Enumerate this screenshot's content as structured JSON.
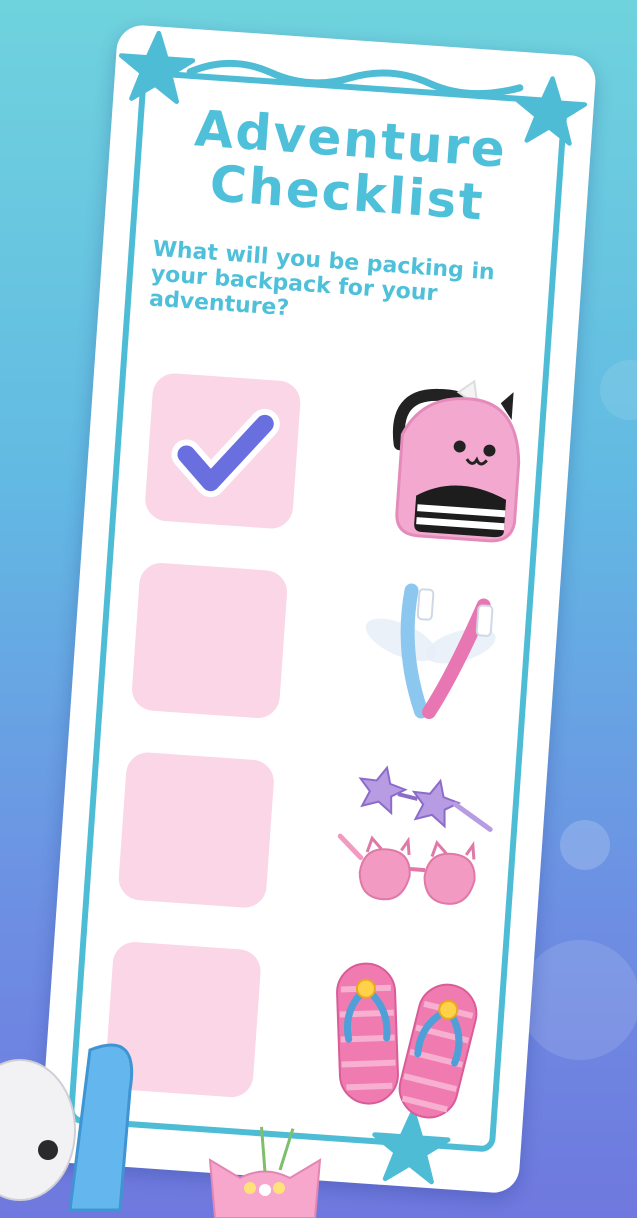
{
  "checklist": {
    "title_line1": "Adventure",
    "title_line2": "Checklist",
    "prompt": "What will you be packing in your backpack for your adventure?",
    "items": [
      {
        "name": "backpack",
        "checked": true
      },
      {
        "name": "toothbrushes",
        "checked": false
      },
      {
        "name": "sunglasses",
        "checked": false
      },
      {
        "name": "flip-flops",
        "checked": false
      }
    ]
  },
  "colors": {
    "accent": "#4fc0d9",
    "checkbox": "#fad6e6",
    "checkmark": "#6a6fe0"
  }
}
